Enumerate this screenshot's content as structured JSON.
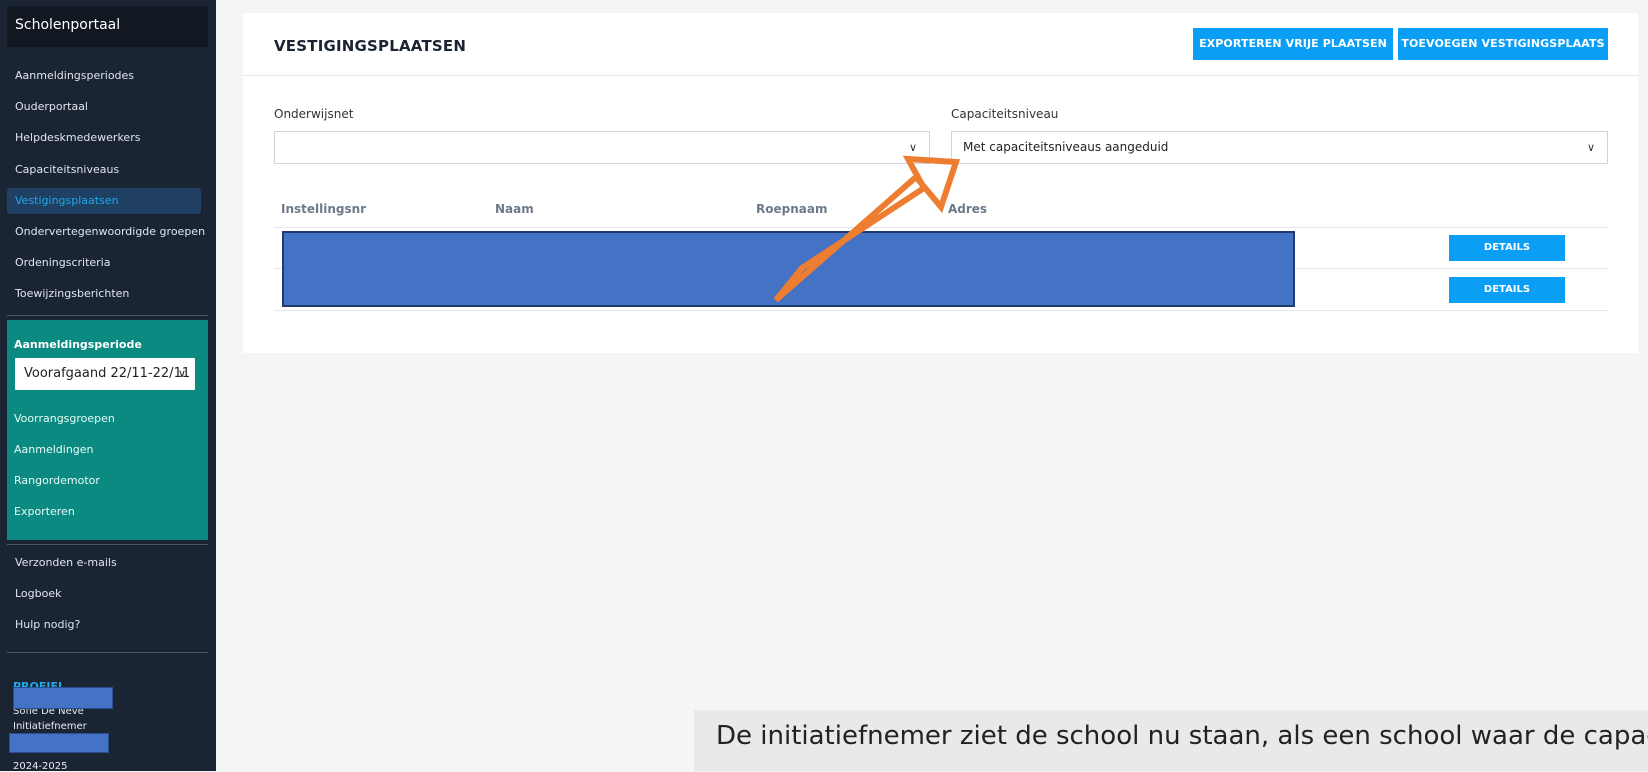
{
  "sidebar": {
    "brand": "Scholenportaal",
    "nav": [
      {
        "label": "Aanmeldingsperiodes",
        "active": false
      },
      {
        "label": "Ouderportaal",
        "active": false
      },
      {
        "label": "Helpdeskmedewerkers",
        "active": false
      },
      {
        "label": "Capaciteitsniveaus",
        "active": false
      },
      {
        "label": "Vestigingsplaatsen",
        "active": true
      },
      {
        "label": "Ondervertegenwoordigde groepen",
        "active": false
      },
      {
        "label": "Ordeningscriteria",
        "active": false
      },
      {
        "label": "Toewijzingsberichten",
        "active": false
      }
    ],
    "period": {
      "title": "Aanmeldingsperiode",
      "selected": "Voorafgaand 22/11-22/11",
      "links": [
        "Voorrangsgroepen",
        "Aanmeldingen",
        "Rangordemotor",
        "Exporteren"
      ]
    },
    "bottom_nav": [
      "Verzonden e-mails",
      "Logboek",
      "Hulp nodig?"
    ],
    "profile": {
      "label": "PROFIEL",
      "name": "Sofie De Neve",
      "role": "Initiatiefnemer",
      "year": "2024-2025"
    }
  },
  "main": {
    "title": "VESTIGINGSPLAATSEN",
    "buttons": {
      "export": "EXPORTEREN VRIJE PLAATSEN",
      "add": "TOEVOEGEN VESTIGINGSPLAATS"
    },
    "filters": {
      "onderwijsnet_label": "Onderwijsnet",
      "onderwijsnet_value": "",
      "capaciteit_label": "Capaciteitsniveau",
      "capaciteit_value": "Met capaciteitsniveaus aangeduid"
    },
    "table": {
      "headers": [
        "Instellingsnr",
        "Naam",
        "Roepnaam",
        "Adres"
      ],
      "row_action": "DETAILS",
      "row_count": 2
    }
  },
  "caption": "De initiatiefnemer ziet de school nu staan, als een school waar de capaciteitsniveau zijn aangeduid.",
  "colors": {
    "sidebar": "#1a2433",
    "accent": "#0b9ef5",
    "period_block": "#0a8a80",
    "annotation_arrow": "#ed7d31",
    "redaction": "#4472c4"
  }
}
